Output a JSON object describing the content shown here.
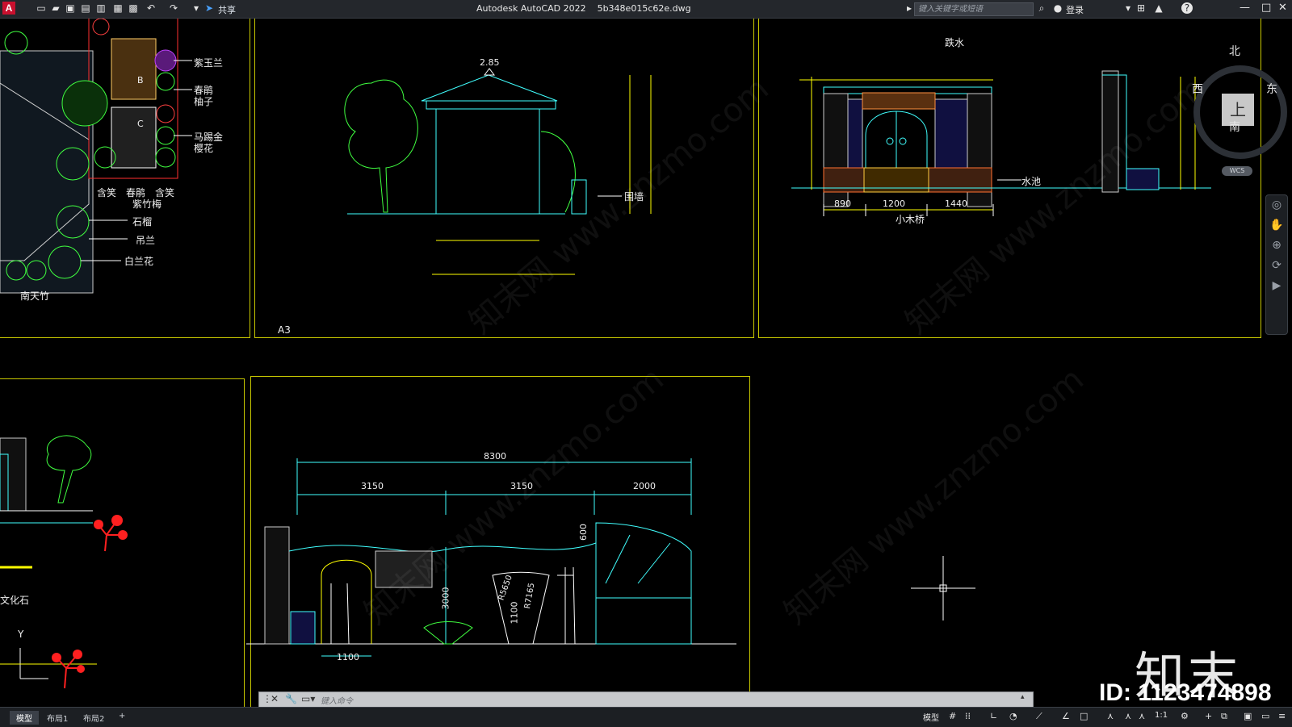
{
  "titlebar": {
    "app_logo": "A",
    "share": "共享",
    "title": "Autodesk AutoCAD 2022    5b348e015c62e.dwg",
    "search_placeholder": "键入关键字或短语",
    "login": "登录",
    "help": "?"
  },
  "plan_labels": [
    "紫玉兰",
    "春鹃",
    "柚子",
    "马踢金",
    "樱花",
    "含笑",
    "春鹃",
    "含笑",
    "紫竹梅",
    "石榴",
    "吊兰",
    "白兰花",
    "南天竹"
  ],
  "plan_marks": {
    "b": "B",
    "c": "C"
  },
  "pavilion": {
    "top": "2.85",
    "wall": "围墙"
  },
  "viewport_label": "A3",
  "gate_elevation": {
    "title": "跌水",
    "pond": "水池",
    "bridge": "小木桥",
    "dims": [
      "890",
      "1200",
      "1440"
    ]
  },
  "wall_elevation": {
    "dims": [
      "8300",
      "3150",
      "3150",
      "2000",
      "1100",
      "600",
      "3000",
      "1100"
    ],
    "radius": "R5650",
    "radius2": "R7165"
  },
  "side_label": "文化石",
  "axis_y": "Y",
  "navcube": {
    "north": "北",
    "south": "南",
    "east": "东",
    "west": "西",
    "top": "上",
    "wcs": "WCS"
  },
  "cmd": {
    "placeholder": "键入命令"
  },
  "layout_tabs": [
    "模型",
    "布局1",
    "布局2",
    "+"
  ],
  "status": {
    "model": "模型",
    "scale": "1:1"
  },
  "brand": "知末",
  "id_text": "ID: 1123474898",
  "watermark": "知末网 www.znzmo.com"
}
